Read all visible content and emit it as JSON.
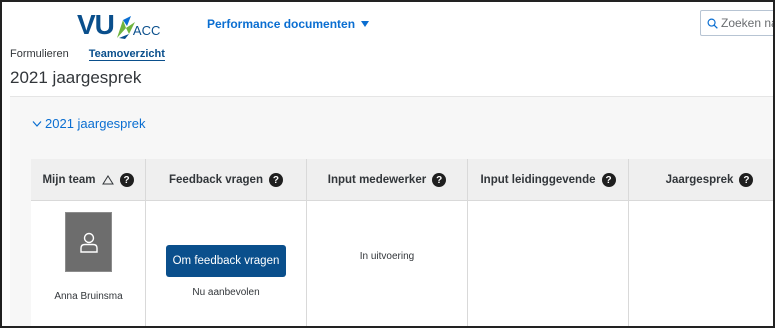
{
  "header": {
    "logo_text": "VU",
    "logo_suffix": "ACC",
    "menu_label": "Performance documenten",
    "search_placeholder": "Zoeken naar"
  },
  "tabs": [
    {
      "label": "Formulieren",
      "active": false
    },
    {
      "label": "Teamoverzicht",
      "active": true
    }
  ],
  "page_title": "2021 jaargesprek",
  "section": {
    "label": "2021 jaargesprek"
  },
  "table": {
    "columns": [
      {
        "label": "Mijn team",
        "sortable": true
      },
      {
        "label": "Feedback vragen",
        "sortable": false
      },
      {
        "label": "Input medewerker",
        "sortable": false
      },
      {
        "label": "Input leidinggevende",
        "sortable": false
      },
      {
        "label": "Jaargesprek",
        "sortable": false
      }
    ],
    "help_glyph": "?",
    "rows": [
      {
        "member_name": "Anna Bruinsma",
        "feedback_button": "Om feedback vragen",
        "feedback_note": "Nu aanbevolen",
        "input_medewerker": "In uitvoering",
        "input_leidinggevende": "",
        "jaargesprek": ""
      }
    ]
  },
  "colors": {
    "brand_dark": "#0a4f8c",
    "link_blue": "#0a6ed1",
    "logo_green": "#6fb43f"
  }
}
